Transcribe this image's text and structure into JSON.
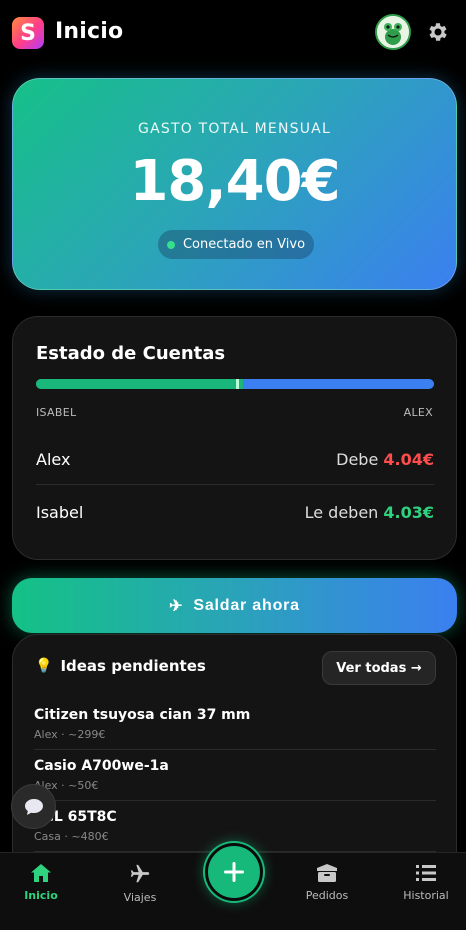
{
  "header": {
    "logo_letter": "S",
    "title": "Inicio"
  },
  "hero": {
    "label": "GASTO TOTAL MENSUAL",
    "amount": "18,40€",
    "status": "Conectado en Vivo"
  },
  "accounts": {
    "title": "Estado de Cuentas",
    "left_name": "ISABEL",
    "right_name": "ALEX",
    "balance_fraction_left": 0.52,
    "rows": [
      {
        "name": "Alex",
        "status": "Debe",
        "amount": "4.04€"
      },
      {
        "name": "Isabel",
        "status": "Le deben",
        "amount": "4.03€"
      }
    ]
  },
  "settle": {
    "icon": "✈",
    "label": "Saldar ahora"
  },
  "ideas": {
    "title": "Ideas pendientes",
    "see_all": "Ver todas →",
    "items": [
      {
        "title": "Citizen tsuyosa cian 37 mm",
        "meta": "Alex · ~299€"
      },
      {
        "title": "Casio A700we-1a",
        "meta": "Alex · ~50€"
      },
      {
        "title": "TCL 65T8C",
        "meta": "Casa · ~480€"
      }
    ]
  },
  "nav": {
    "items": [
      {
        "label": "Inicio",
        "icon": "home-icon"
      },
      {
        "label": "Viajes",
        "icon": "plane-icon"
      },
      {
        "label": "Pedidos",
        "icon": "box-icon"
      },
      {
        "label": "Historial",
        "icon": "list-icon"
      }
    ],
    "add_icon": "plus-icon"
  },
  "colors": {
    "accent_green": "#17b97b",
    "accent_blue": "#3b7ff0",
    "debt_red": "#ff4d4d",
    "credit_green": "#2fd27e"
  }
}
